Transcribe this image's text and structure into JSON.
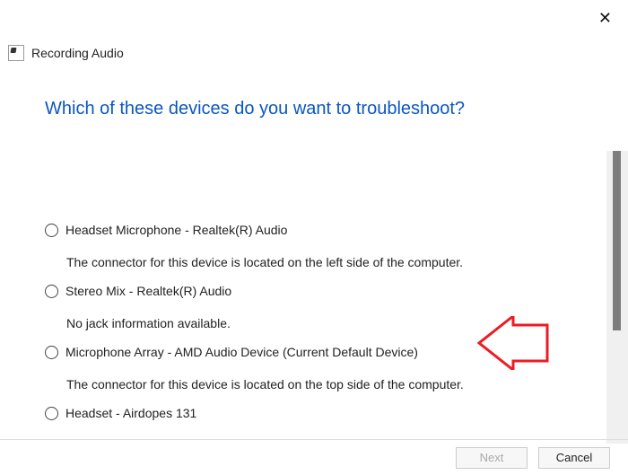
{
  "close_label": "✕",
  "titlebar": {
    "title": "Recording Audio"
  },
  "heading": "Which of these devices do you want to troubleshoot?",
  "devices": [
    {
      "label": "Headset Microphone - Realtek(R) Audio",
      "desc": "The connector for this device is located on the left side of the computer."
    },
    {
      "label": "Stereo Mix - Realtek(R) Audio",
      "desc": "No jack information available."
    },
    {
      "label": "Microphone Array - AMD Audio Device (Current Default Device)",
      "desc": "The connector for this device is located on the top side of the computer."
    },
    {
      "label": "Headset - Airdopes 131",
      "desc": ""
    }
  ],
  "buttons": {
    "next": "Next",
    "cancel": "Cancel"
  }
}
